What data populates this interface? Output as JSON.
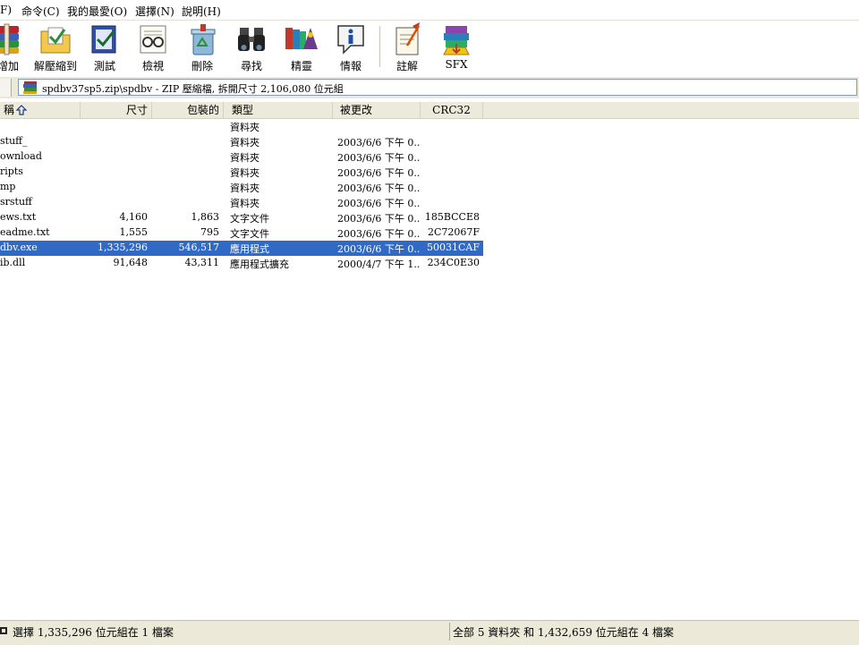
{
  "menu": {
    "items": [
      {
        "label": "F)"
      },
      {
        "label": "命令(C)"
      },
      {
        "label": "我的最愛(O)"
      },
      {
        "label": "選擇(N)"
      },
      {
        "label": "說明(H)"
      }
    ]
  },
  "toolbar": {
    "buttons": [
      {
        "label": "增加",
        "icon": "books-add-icon"
      },
      {
        "label": "解壓縮到",
        "icon": "extract-folder-icon"
      },
      {
        "label": "測試",
        "icon": "test-check-icon"
      },
      {
        "label": "檢視",
        "icon": "view-glasses-icon"
      },
      {
        "label": "刪除",
        "icon": "delete-recycle-icon"
      },
      {
        "label": "尋找",
        "icon": "find-binoculars-icon"
      },
      {
        "label": "精靈",
        "icon": "wizard-icon"
      },
      {
        "label": "情報",
        "icon": "info-icon"
      },
      {
        "label": "註解",
        "icon": "comment-icon"
      },
      {
        "label": "SFX",
        "icon": "sfx-icon"
      }
    ]
  },
  "address": {
    "text": "spdbv37sp5.zip\\spdbv - ZIP 壓縮檔, 拆開尺寸 2,106,080 位元組"
  },
  "columns": {
    "name": "稱",
    "size": "尺寸",
    "packed": "包裝的",
    "type": "類型",
    "modified": "被更改",
    "crc": "CRC32"
  },
  "rows": [
    {
      "name": "",
      "size": "",
      "packed": "",
      "type": "資料夾",
      "modified": "",
      "crc": "",
      "selected": false
    },
    {
      "name": "stuff_",
      "size": "",
      "packed": "",
      "type": "資料夾",
      "modified": "2003/6/6 下午 0...",
      "crc": "",
      "selected": false
    },
    {
      "name": "ownload",
      "size": "",
      "packed": "",
      "type": "資料夾",
      "modified": "2003/6/6 下午 0...",
      "crc": "",
      "selected": false
    },
    {
      "name": "ripts",
      "size": "",
      "packed": "",
      "type": "資料夾",
      "modified": "2003/6/6 下午 0...",
      "crc": "",
      "selected": false
    },
    {
      "name": "mp",
      "size": "",
      "packed": "",
      "type": "資料夾",
      "modified": "2003/6/6 下午 0...",
      "crc": "",
      "selected": false
    },
    {
      "name": "srstuff",
      "size": "",
      "packed": "",
      "type": "資料夾",
      "modified": "2003/6/6 下午 0...",
      "crc": "",
      "selected": false
    },
    {
      "name": "ews.txt",
      "size": "4,160",
      "packed": "1,863",
      "type": "文字文件",
      "modified": "2003/6/6 下午 0...",
      "crc": "185BCCE8",
      "selected": false
    },
    {
      "name": "eadme.txt",
      "size": "1,555",
      "packed": "795",
      "type": "文字文件",
      "modified": "2003/6/6 下午 0...",
      "crc": "2C72067F",
      "selected": false
    },
    {
      "name": "dbv.exe",
      "size": "1,335,296",
      "packed": "546,517",
      "type": "應用程式",
      "modified": "2003/6/6 下午 0...",
      "crc": "50031CAF",
      "selected": true
    },
    {
      "name": "ib.dll",
      "size": "91,648",
      "packed": "43,311",
      "type": "應用程式擴充",
      "modified": "2000/4/7 下午 1...",
      "crc": "234C0E30",
      "selected": false
    }
  ],
  "status": {
    "left": "選擇 1,335,296 位元組在 1 檔案",
    "right": "全部 5 資料夾 和 1,432,659 位元組在 4 檔案"
  },
  "colors": {
    "selection": "#316ac5",
    "header_bg": "#ebeadb",
    "statusbar_bg": "#ece9d8"
  }
}
